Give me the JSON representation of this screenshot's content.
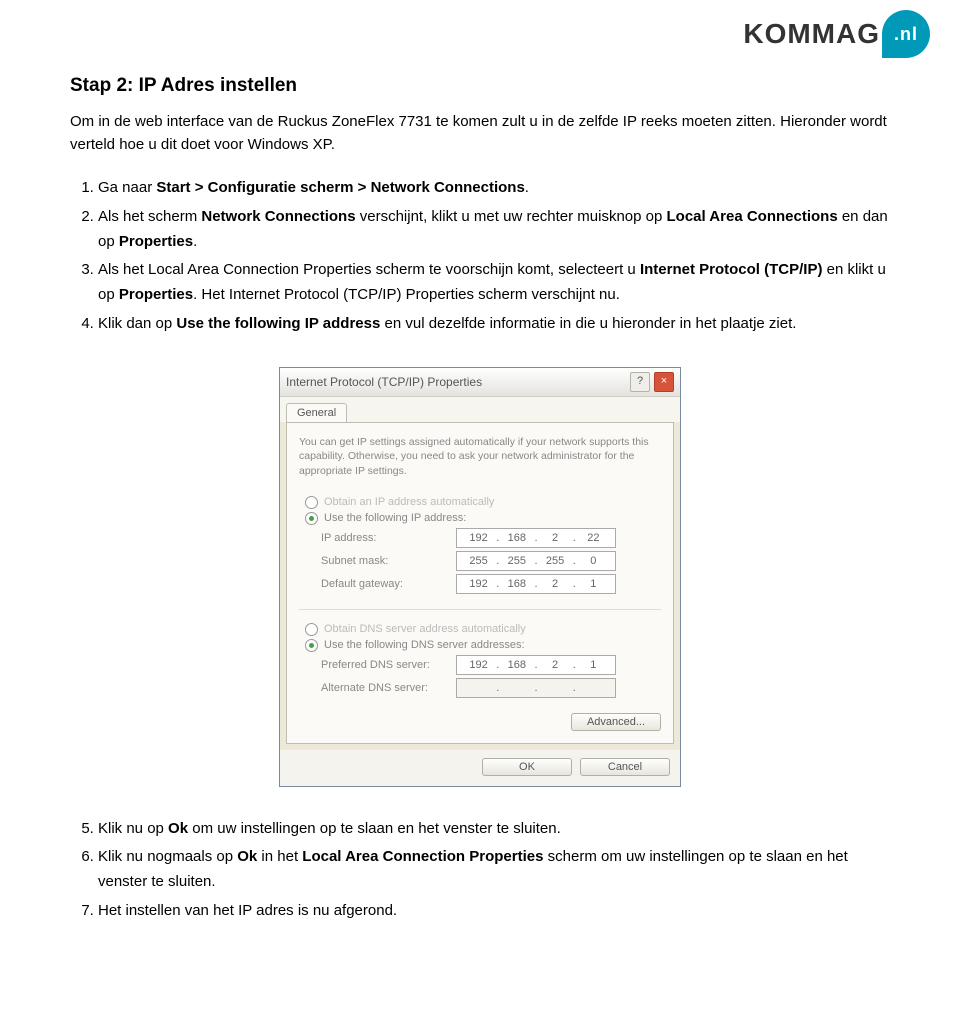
{
  "logo": {
    "brand_text": "KOMMAG",
    "badge_text": ".nl"
  },
  "section_title": "Stap 2: IP Adres instellen",
  "intro": "Om in de web interface van de Ruckus ZoneFlex 7731 te komen zult u in de zelfde IP reeks moeten zitten. Hieronder wordt verteld hoe u dit doet voor Windows XP.",
  "steps_top": [
    {
      "pre": "Ga naar ",
      "b1": "Start > Configuratie scherm > Network Connections",
      "post": "."
    },
    {
      "pre": "Als het scherm ",
      "b1": "Network Connections",
      "mid1": " verschijnt, klikt u met uw rechter muisknop op ",
      "b2": "Local Area Connections",
      "mid2": " en dan op ",
      "b3": "Properties",
      "post": "."
    },
    {
      "pre": "Als het Local Area Connection Properties scherm te voorschijn komt, selecteert u ",
      "b1": "Internet Protocol (TCP/IP)",
      "mid1": " en klikt u op ",
      "b2": "Properties",
      "post": ". Het Internet Protocol (TCP/IP) Properties scherm verschijnt nu."
    },
    {
      "pre": "Klik dan op ",
      "b1": "Use the following IP address",
      "post": " en vul dezelfde informatie in die u hieronder in het plaatje ziet."
    }
  ],
  "dialog": {
    "title": "Internet Protocol (TCP/IP) Properties",
    "help": "?",
    "close": "×",
    "tab": "General",
    "description": "You can get IP settings assigned automatically if your network supports this capability. Otherwise, you need to ask your network administrator for the appropriate IP settings.",
    "r_obtain_ip": "Obtain an IP address automatically",
    "r_use_ip": "Use the following IP address:",
    "lbl_ip": "IP address:",
    "lbl_mask": "Subnet mask:",
    "lbl_gw": "Default gateway:",
    "r_obtain_dns": "Obtain DNS server address automatically",
    "r_use_dns": "Use the following DNS server addresses:",
    "lbl_pref_dns": "Preferred DNS server:",
    "lbl_alt_dns": "Alternate DNS server:",
    "ip": [
      "192",
      "168",
      "2",
      "22"
    ],
    "mask": [
      "255",
      "255",
      "255",
      "0"
    ],
    "gw": [
      "192",
      "168",
      "2",
      "1"
    ],
    "pref_dns": [
      "192",
      "168",
      "2",
      "1"
    ],
    "alt_dns": [
      "",
      "",
      "",
      ""
    ],
    "btn_advanced": "Advanced...",
    "btn_ok": "OK",
    "btn_cancel": "Cancel"
  },
  "steps_bottom": [
    {
      "n": "5.",
      "pre": "Klik nu op ",
      "b1": "Ok",
      "post": " om uw instellingen op te slaan en het venster te sluiten."
    },
    {
      "n": "6.",
      "pre": "Klik nu nogmaals op ",
      "b1": "Ok",
      "mid1": " in het ",
      "b2": "Local Area Connection Properties",
      "post": " scherm om uw instellingen op te slaan en het venster te sluiten."
    },
    {
      "n": "7.",
      "pre": "Het instellen van het IP adres is nu afgerond.",
      "b1": "",
      "post": ""
    }
  ]
}
